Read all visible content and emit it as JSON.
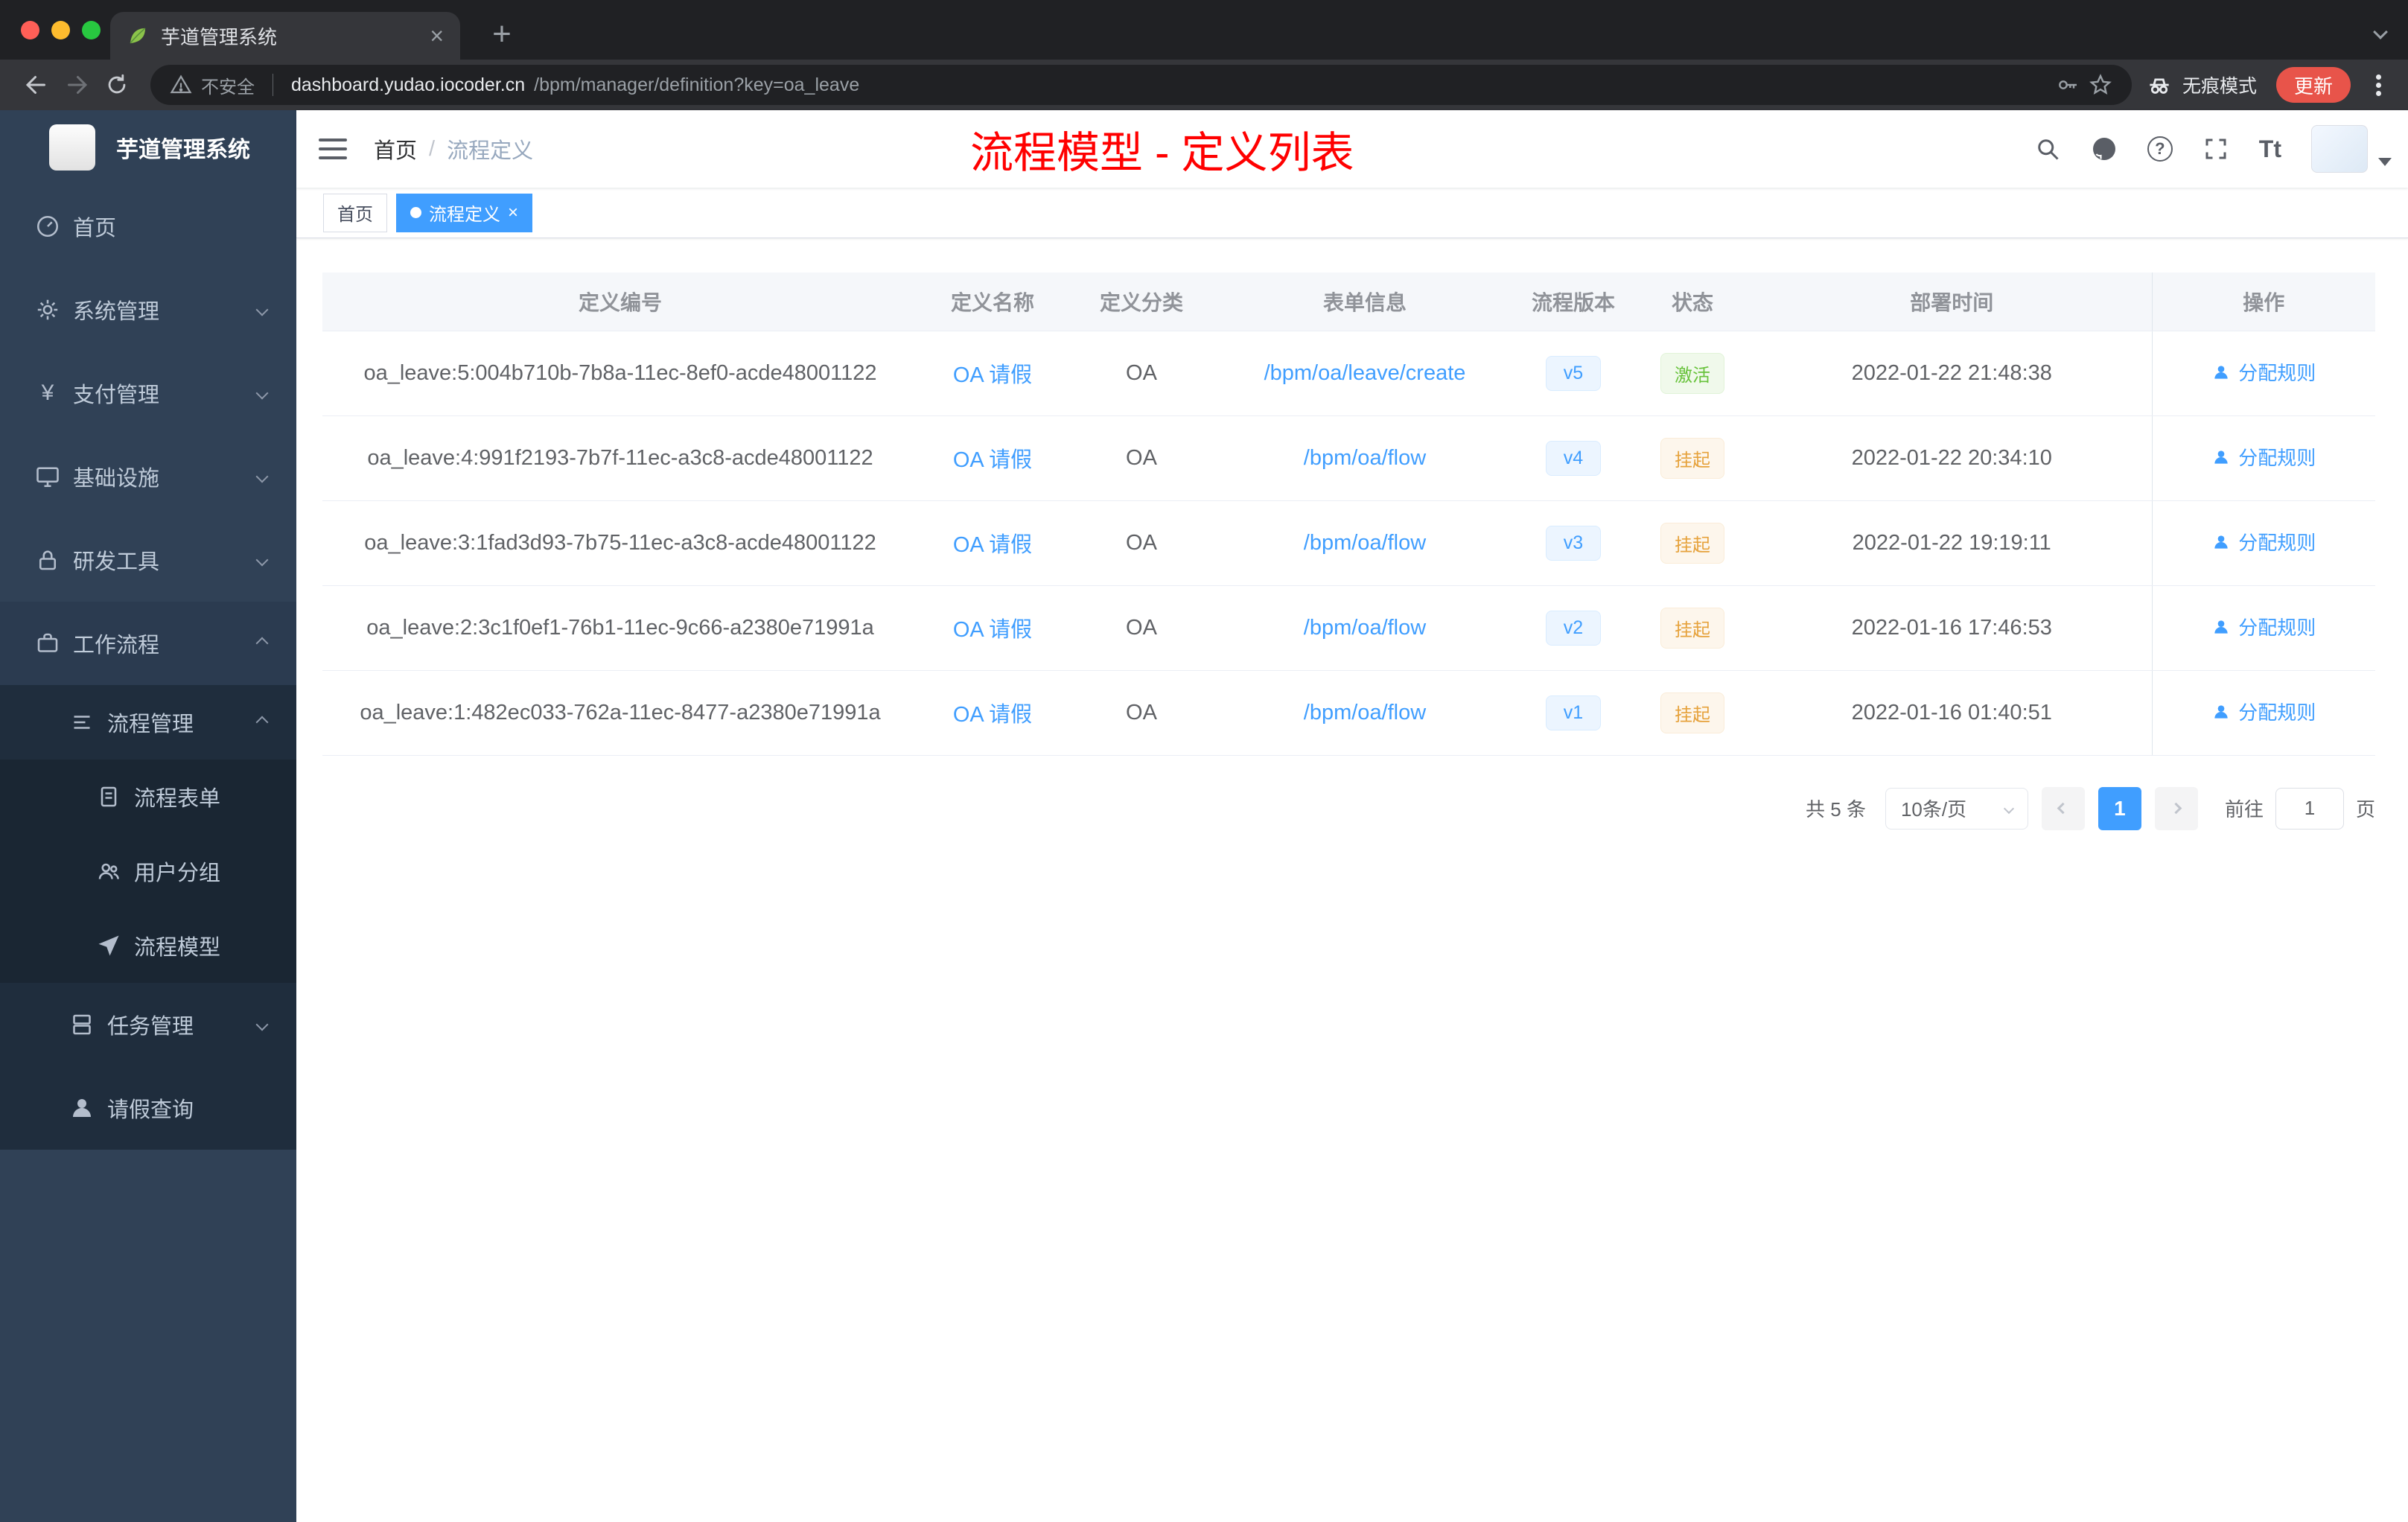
{
  "colors": {
    "accent": "#409eff",
    "success": "#67c23a",
    "warning": "#e6a23c",
    "annotation_red": "#ff0000",
    "sidebar_bg": "#304156",
    "submenu_bg": "#1f2d3d",
    "version_badge_bg": "#ecf5ff",
    "success_badge_bg": "#f0f9eb",
    "warning_badge_bg": "#fdf6ec"
  },
  "icons": {
    "close": "×",
    "new_tab": "+",
    "question_glyph": "?",
    "payment_glyph": "¥",
    "font_size_glyph": "Tt"
  },
  "browser": {
    "tab": {
      "title": "芋道管理系统"
    },
    "address": {
      "security": "不安全",
      "host": "dashboard.yudao.iocoder.cn",
      "path": "/bpm/manager/definition?key=oa_leave"
    },
    "incognito": "无痕模式",
    "update": "更新"
  },
  "sidebar": {
    "app_title": "芋道管理系统",
    "items": [
      {
        "label": "首页"
      },
      {
        "label": "系统管理"
      },
      {
        "label": "支付管理"
      },
      {
        "label": "基础设施"
      },
      {
        "label": "研发工具"
      },
      {
        "label": "工作流程"
      }
    ],
    "process_mgmt": {
      "label": "流程管理"
    },
    "process_children": [
      {
        "label": "流程表单"
      },
      {
        "label": "用户分组"
      },
      {
        "label": "流程模型"
      }
    ],
    "task_mgmt": {
      "label": "任务管理"
    },
    "leave_query": {
      "label": "请假查询"
    }
  },
  "navbar": {
    "breadcrumb_home": "首页",
    "breadcrumb_sep": "/",
    "breadcrumb_current": "流程定义",
    "annotation": "流程模型 - 定义列表"
  },
  "tags": {
    "home_label": "首页",
    "active_label": "流程定义"
  },
  "table": {
    "columns": [
      "定义编号",
      "定义名称",
      "定义分类",
      "表单信息",
      "流程版本",
      "状态",
      "部署时间",
      "操作"
    ],
    "rows": [
      {
        "id": "oa_leave:5:004b710b-7b8a-11ec-8ef0-acde48001122",
        "name": "OA 请假",
        "category": "OA",
        "form": "/bpm/oa/leave/create",
        "version": "v5",
        "status": "激活",
        "time": "2022-01-22 21:48:38",
        "action": "分配规则"
      },
      {
        "id": "oa_leave:4:991f2193-7b7f-11ec-a3c8-acde48001122",
        "name": "OA 请假",
        "category": "OA",
        "form": "/bpm/oa/flow",
        "version": "v4",
        "status": "挂起",
        "time": "2022-01-22 20:34:10",
        "action": "分配规则"
      },
      {
        "id": "oa_leave:3:1fad3d93-7b75-11ec-a3c8-acde48001122",
        "name": "OA 请假",
        "category": "OA",
        "form": "/bpm/oa/flow",
        "version": "v3",
        "status": "挂起",
        "time": "2022-01-22 19:19:11",
        "action": "分配规则"
      },
      {
        "id": "oa_leave:2:3c1f0ef1-76b1-11ec-9c66-a2380e71991a",
        "name": "OA 请假",
        "category": "OA",
        "form": "/bpm/oa/flow",
        "version": "v2",
        "status": "挂起",
        "time": "2022-01-16 17:46:53",
        "action": "分配规则"
      },
      {
        "id": "oa_leave:1:482ec033-762a-11ec-8477-a2380e71991a",
        "name": "OA 请假",
        "category": "OA",
        "form": "/bpm/oa/flow",
        "version": "v1",
        "status": "挂起",
        "time": "2022-01-16 01:40:51",
        "action": "分配规则"
      }
    ]
  },
  "pagination": {
    "total": "共 5 条",
    "page_size": "10条/页",
    "page": "1",
    "goto_label": "前往",
    "goto_value": "1",
    "unit_label": "页"
  }
}
